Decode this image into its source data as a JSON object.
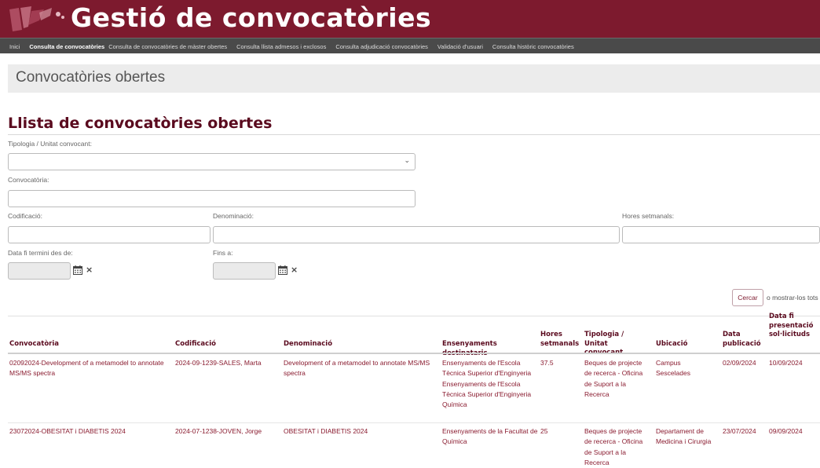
{
  "app": {
    "title": "Gestió de convocatòries"
  },
  "nav": {
    "items": [
      {
        "label": "Inici"
      },
      {
        "label": "Consulta de convocatòries"
      },
      {
        "label": "Consulta de convocatòries de màster obertes"
      },
      {
        "label": "Consulta llista admesos i exclosos"
      },
      {
        "label": "Consulta adjudicació convocatòries"
      },
      {
        "label": "Validació d'usuari"
      },
      {
        "label": "Consulta històric convocatòries"
      }
    ],
    "active_index": 1
  },
  "page": {
    "header": "Convocatòries obertes",
    "section_title": "Llista de convocatòries obertes"
  },
  "filters": {
    "tipologia": {
      "label": "Tipologia / Unitat convocant:",
      "value": ""
    },
    "convocatoria": {
      "label": "Convocatòria:",
      "value": ""
    },
    "codificacio": {
      "label": "Codificació:",
      "value": ""
    },
    "denominacio": {
      "label": "Denominació:",
      "value": ""
    },
    "hores": {
      "label": "Hores setmanals:",
      "value": ""
    },
    "data_fi": {
      "label": "Data fi termini des de:",
      "value": ""
    },
    "fins_a": {
      "label": "Fins a:",
      "value": ""
    },
    "search_button": "Cercar",
    "show_all_text": "o mostrar-los tots"
  },
  "table": {
    "headers": {
      "convocatoria": "Convocatòria",
      "codificacio": "Codificació",
      "denominacio": "Denominació",
      "ensenyaments": "Ensenyaments destinataris",
      "hores": "Hores setmanals",
      "tipologia": "Tipologia / Unitat convocant",
      "ubicacio": "Ubicació",
      "data_pub": "Data publicació",
      "data_fi": "Data fi presentació sol·licituds"
    },
    "rows": [
      {
        "convocatoria": "02092024-Development of a metamodel to annotate MS/MS spectra",
        "codificacio": "2024-09-1239-SALES, Marta",
        "denominacio": "Development of a metamodel to annotate MS/MS spectra",
        "ensenyaments": "Ensenyaments de l'Escola Tècnica Superior d'Enginyeria Ensenyaments de l'Escola Tècnica Superior d'Enginyeria Química",
        "hores": "37.5",
        "tipologia": "Beques de projecte de recerca - Oficina de Suport a la Recerca",
        "ubicacio": "Campus Sescelades",
        "data_pub": "02/09/2024",
        "data_fi": "10/09/2024"
      },
      {
        "convocatoria": "23072024-OBESITAT i DIABETIS 2024",
        "codificacio": "2024-07-1238-JOVEN, Jorge",
        "denominacio": "OBESITAT i DIABETIS 2024",
        "ensenyaments": "Ensenyaments de la Facultat de Química",
        "hores": "25",
        "tipologia": "Beques de projecte de recerca - Oficina de Suport a la Recerca",
        "ubicacio": "Departament de Medicina i Cirurgia",
        "data_pub": "23/07/2024",
        "data_fi": "09/09/2024"
      }
    ]
  },
  "icons": {
    "calendar": "calendar-icon",
    "clear": "clear-icon",
    "dropdown": "chevron-down-icon"
  },
  "colors": {
    "brand": "#7d1a2e",
    "nav": "#4a4a4a",
    "heading": "#5a0a1e"
  }
}
